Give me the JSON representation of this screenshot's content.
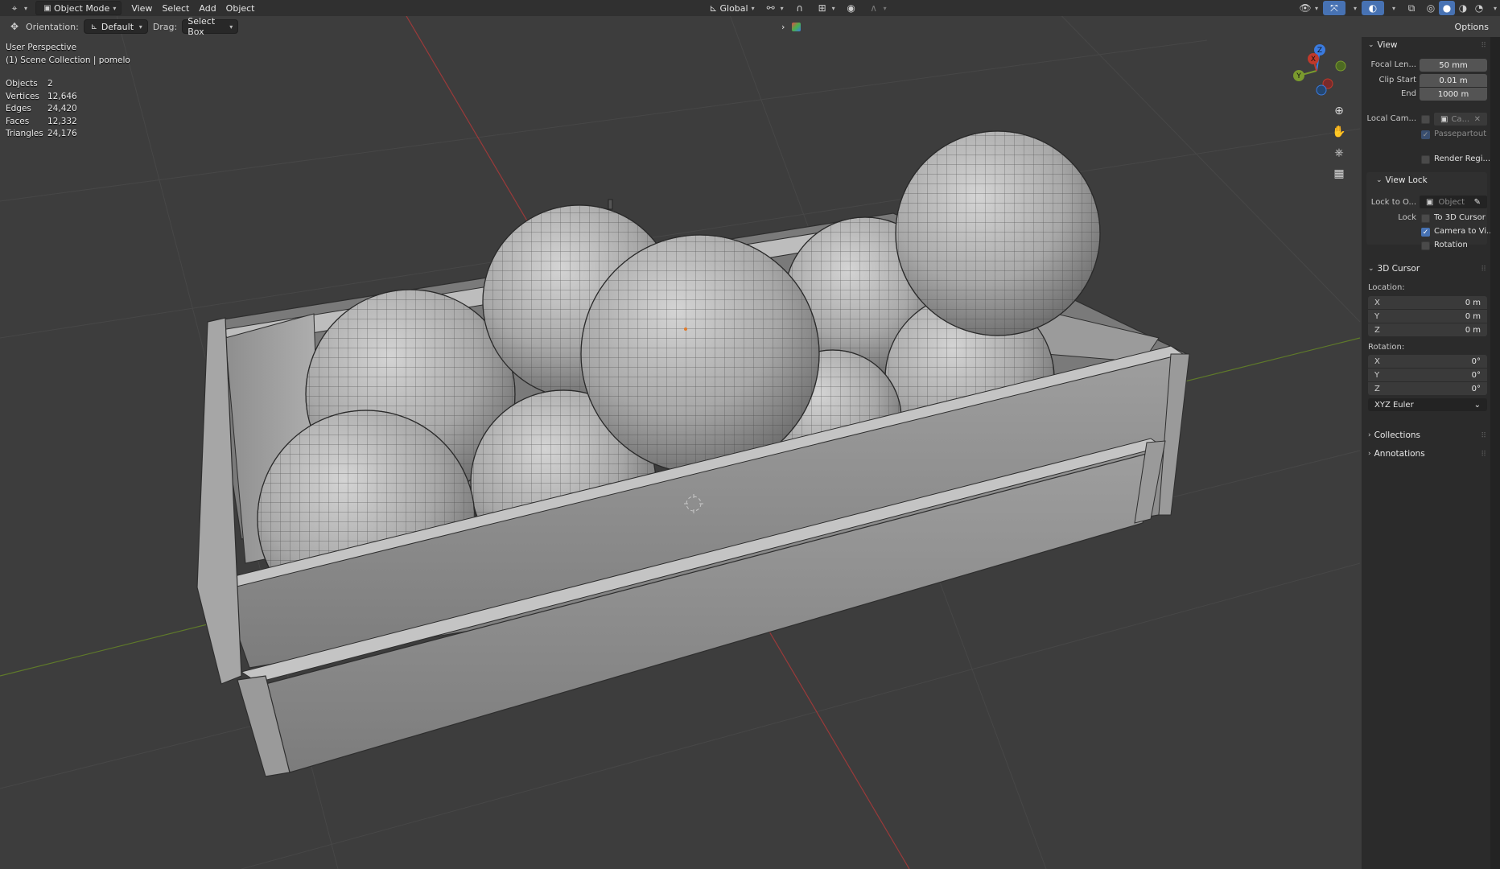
{
  "header": {
    "mode_label": "Object Mode",
    "menus": [
      "View",
      "Select",
      "Add",
      "Object"
    ],
    "transform_orientation": "Global"
  },
  "toolbar": {
    "orientation_label": "Orientation:",
    "orientation_value": "Default",
    "drag_label": "Drag:",
    "drag_value": "Select Box",
    "options_label": "Options"
  },
  "overlay": {
    "view_name": "User Perspective",
    "collection": "(1) Scene Collection | pomelo",
    "stats": [
      {
        "label": "Objects",
        "value": "2"
      },
      {
        "label": "Vertices",
        "value": "12,646"
      },
      {
        "label": "Edges",
        "value": "24,420"
      },
      {
        "label": "Faces",
        "value": "12,332"
      },
      {
        "label": "Triangles",
        "value": "24,176"
      }
    ]
  },
  "gizmo": {
    "x": "X",
    "y": "Y",
    "z": "Z"
  },
  "npanel": {
    "view": {
      "title": "View",
      "focal_label": "Focal Len...",
      "focal_value": "50 mm",
      "clip_start_label": "Clip Start",
      "clip_start_value": "0.01 m",
      "clip_end_label": "End",
      "clip_end_value": "1000 m",
      "local_cam_label": "Local Cam...",
      "local_cam_value": "Ca...",
      "passepartout_label": "Passepartout",
      "render_region_label": "Render Regi..."
    },
    "view_lock": {
      "title": "View Lock",
      "lock_to_label": "Lock to O...",
      "lock_to_placeholder": "Object",
      "lock_label": "Lock",
      "to_cursor_label": "To 3D Cursor",
      "camera_to_view_label": "Camera to Vi...",
      "rotation_label": "Rotation"
    },
    "cursor": {
      "title": "3D Cursor",
      "location_label": "Location:",
      "loc": [
        {
          "axis": "X",
          "value": "0 m"
        },
        {
          "axis": "Y",
          "value": "0 m"
        },
        {
          "axis": "Z",
          "value": "0 m"
        }
      ],
      "rotation_label": "Rotation:",
      "rot": [
        {
          "axis": "X",
          "value": "0°"
        },
        {
          "axis": "Y",
          "value": "0°"
        },
        {
          "axis": "Z",
          "value": "0°"
        }
      ],
      "mode_value": "XYZ Euler"
    },
    "collections_title": "Collections",
    "annotations_title": "Annotations"
  },
  "colors": {
    "background": "#3d3d3d",
    "x_axis": "#c0392b",
    "y_axis": "#7a9a2e",
    "z_axis": "#3a7be0",
    "accent": "#4772b3"
  }
}
